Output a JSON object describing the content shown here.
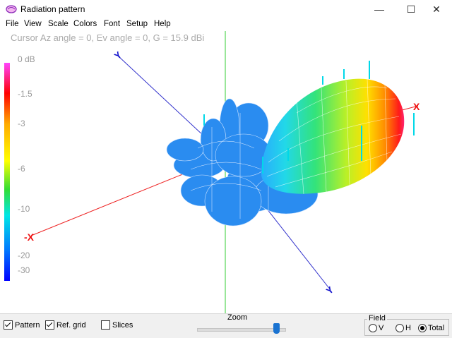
{
  "window": {
    "title": "Radiation pattern",
    "minimize": "—",
    "maximize": "☐",
    "close": "✕"
  },
  "menu": [
    "File",
    "View",
    "Scale",
    "Colors",
    "Font",
    "Setup",
    "Help"
  ],
  "cursor_readout": "Cursor Az angle = 0,  Ev angle = 0,  G = 15.9 dBi",
  "scale": {
    "labels": [
      "0 dB",
      "-1.5",
      "-3",
      "-6",
      "-10",
      "-20",
      "-30"
    ],
    "colors": [
      "#ff44ff",
      "#ff0000",
      "#ffaa00",
      "#ffff00",
      "#33dd33",
      "#00e6e6",
      "#0077ff",
      "#0000ff"
    ]
  },
  "axis_markers": {
    "x": "-X",
    "y": "Y"
  },
  "bottom": {
    "pattern": {
      "label": "Pattern",
      "checked": true
    },
    "ref_grid": {
      "label": "Ref. grid",
      "checked": true
    },
    "slices": {
      "label": "Slices",
      "checked": false
    },
    "zoom": {
      "label": "Zoom",
      "value": 0.9
    },
    "field": {
      "label": "Field",
      "options": [
        {
          "label": "V",
          "selected": false
        },
        {
          "label": "H",
          "selected": false
        },
        {
          "label": "Total",
          "selected": true
        }
      ]
    }
  }
}
